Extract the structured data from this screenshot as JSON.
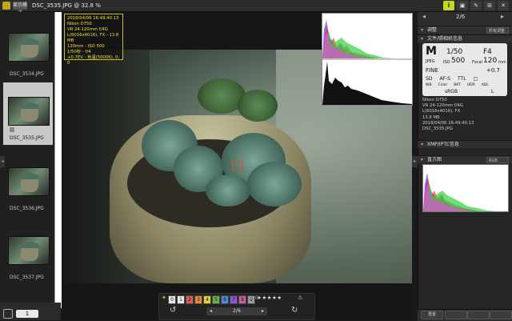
{
  "window": {
    "title": "DSC_3535.JPG @ 32.8 %",
    "view_label": "显示模式"
  },
  "toolbar": {
    "buttons": [
      "i",
      "▣",
      "✎",
      "⊞",
      "✕"
    ]
  },
  "filmstrip": {
    "items": [
      {
        "label": "DSC_3534.JPG",
        "selected": false
      },
      {
        "label": "DSC_3535.JPG",
        "selected": true
      },
      {
        "label": "DSC_3536.JPG",
        "selected": false
      },
      {
        "label": "DSC_3537.JPG",
        "selected": false
      }
    ],
    "page": "1"
  },
  "info_overlay": {
    "lines": [
      "2018/04/06 16:49:40.13",
      "Nikon D750",
      "VR 24-120mm f/4G",
      "L(6016x4016), FX - 13.8 MB",
      "120mm - ISO 500",
      "1/50秒 - f/4",
      "+0.7EV - 色温(5000K), 0, 0"
    ]
  },
  "bottom_toolbar": {
    "labels": [
      "0",
      "1",
      "2",
      "3",
      "4",
      "5",
      "6",
      "7",
      "8",
      "9"
    ],
    "label_colors": [
      "#e8e8e8",
      "#e8e8e8",
      "#e05a5a",
      "#e08a3a",
      "#e0d03a",
      "#6ab04a",
      "#4a8ad0",
      "#8a5ad0",
      "#d05aa0",
      "#9a9a9a"
    ],
    "rating_icon": "⊘ 0",
    "stars": "★★★★★",
    "nav": "2/6",
    "prev": "◂",
    "next": "▸"
  },
  "right_panel": {
    "counter": "2/6",
    "adjust": {
      "title": "调整",
      "dropdown": "所有调整"
    },
    "fileinfo": {
      "title": "文件/照相机信息",
      "mode": "M",
      "shutter": "1/50",
      "aperture": "F4",
      "iso_label": "ISO",
      "iso": "500",
      "focal_label": "Focal",
      "focal": "120",
      "focal_unit": "mm",
      "jpeg": "JPEG",
      "fine": "FINE",
      "ev": "+0.7",
      "row_icons": [
        "SD",
        "AF-S",
        "TTL",
        "□"
      ],
      "row_labels": [
        "WB",
        "Color",
        "BKT",
        "HDR",
        "ADL"
      ],
      "colorspace": "sRGB",
      "flash": "L"
    },
    "meta": [
      "Nikon D750",
      "VR 24-120mm f/4G",
      "L(6016x4016), FX",
      "13.8 MB",
      "2018/04/06 16:49:40.13",
      "DSC_3535.JPG"
    ],
    "xmp": {
      "title": "XMP/IPTC信息"
    },
    "histogram": {
      "title": "直方图",
      "dropdown": "RGB"
    },
    "footer": [
      "重置",
      "",
      "",
      ""
    ]
  },
  "colors": {
    "accent": "#c9d71c",
    "focus_point": "#e24a2a",
    "info_text": "#f0e040"
  }
}
